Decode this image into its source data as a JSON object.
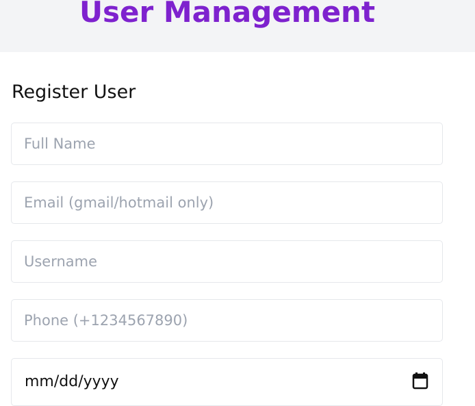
{
  "header": {
    "title": "User Management"
  },
  "form": {
    "title": "Register User",
    "fields": {
      "full_name": {
        "placeholder": "Full Name",
        "value": ""
      },
      "email": {
        "placeholder": "Email (gmail/hotmail only)",
        "value": ""
      },
      "username": {
        "placeholder": "Username",
        "value": ""
      },
      "phone": {
        "placeholder": "Phone (+1234567890)",
        "value": ""
      },
      "dob": {
        "display": "mm/dd/yyyy",
        "icon": "calendar-icon"
      }
    }
  },
  "colors": {
    "accent": "#7e22ce",
    "header_bg": "#f3f4f6",
    "border": "#e5e7eb",
    "placeholder": "#9ca3af"
  }
}
